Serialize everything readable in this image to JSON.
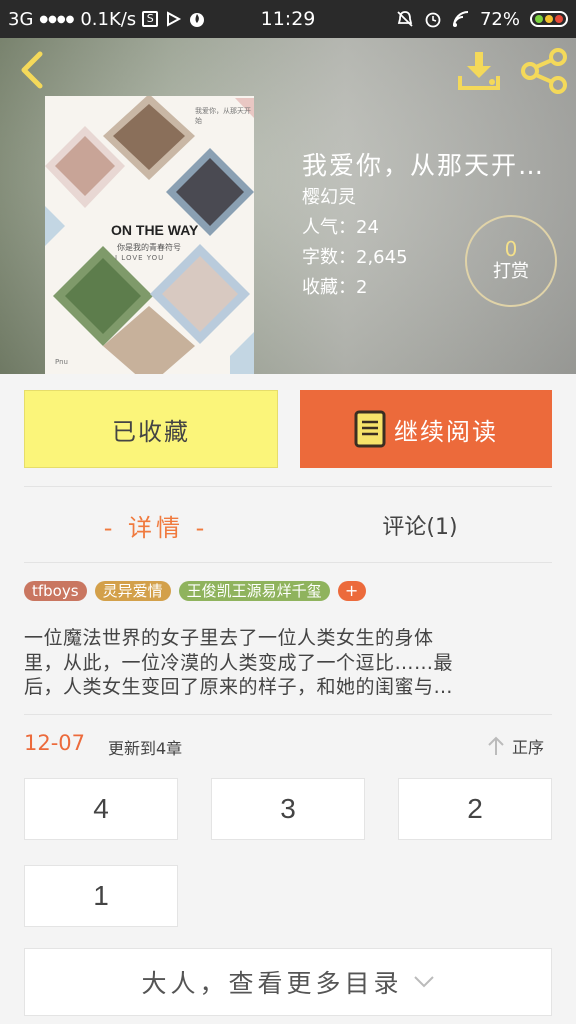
{
  "status_bar": {
    "network": "3G",
    "signal_dots": "●●●●",
    "speed": "0.1K/s",
    "time": "11:29",
    "battery": "72%"
  },
  "header": {
    "back_icon": "chevron-left-icon",
    "download_icon": "download-icon",
    "share_icon": "share-icon"
  },
  "cover": {
    "title": "ON THE WAY",
    "subtitle": "你是我的青春符号",
    "love_text": "I  LOVE  YOU",
    "corner_note": "我爱你，从那天开始",
    "signature": "Pnu"
  },
  "book": {
    "title": "我爱你，从那天开…",
    "author": "樱幻灵",
    "popularity": "人气：24",
    "word_count": "字数：2,645",
    "favorites": "收藏：2"
  },
  "tip": {
    "count": "0",
    "label": "打赏"
  },
  "actions": {
    "collected_label": "已收藏",
    "read_label": "继续阅读",
    "read_icon": "book-icon"
  },
  "tabs": {
    "detail": "- 详情 -",
    "comment": "评论(1)"
  },
  "tags": [
    "tfboys",
    "灵异爱情",
    "王俊凯王源易烊千玺"
  ],
  "tag_add": "+",
  "tag_colors": [
    "#c97660",
    "#d3a04a",
    "#8fb35d",
    "#ec6a3b"
  ],
  "summary": {
    "line1": "一位魔法世界的女子里去了一位人类女生的身体",
    "line2": "里，从此，一位冷漠的人类变成了一个逗比……最",
    "line3": "后，人类女生变回了原来的样子，和她的闺蜜与…"
  },
  "update": {
    "date": "12-07",
    "text": "更新到4章",
    "sort_label": "正序",
    "sort_icon": "arrow-up-icon"
  },
  "chapters": [
    "4",
    "3",
    "2",
    "1"
  ],
  "more": {
    "label": "大人，查看更多目录",
    "icon": "chevron-down-icon"
  },
  "colors": {
    "accent": "#ec6a3b",
    "collected_bg": "#fbf57a",
    "tip_count": "#f4e08a"
  }
}
